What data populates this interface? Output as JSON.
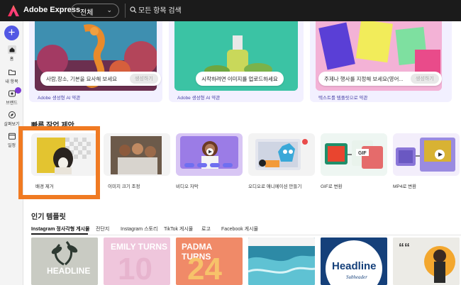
{
  "header": {
    "app_title": "Adobe Express",
    "scope_selected": "전체",
    "search_placeholder": "모든 항목 검색"
  },
  "rail": {
    "create_label": "+",
    "items": [
      {
        "label": "홈",
        "icon": "home-icon",
        "active": true
      },
      {
        "label": "내 항목",
        "icon": "folder-icon",
        "active": false
      },
      {
        "label": "브랜드",
        "icon": "brand-icon",
        "active": false
      },
      {
        "label": "살펴보기",
        "icon": "compass-icon",
        "active": false
      },
      {
        "label": "일정",
        "icon": "calendar-icon",
        "active": false
      }
    ]
  },
  "generative": {
    "cards": [
      {
        "prompt": "사람,장소, 기본을 묘사해 보세요",
        "button": "생성하기",
        "caption": "Adobe 생성형 AI 약관"
      },
      {
        "upload": "시작하려면 이미지를 업로드하세요",
        "caption": "Adobe 생성형 AI 약관"
      },
      {
        "prompt": "주제나 행사를 지정해 보세요(영어...",
        "button": "생성하기",
        "caption": "텍스트를 템플릿으로 약관"
      }
    ]
  },
  "quick_actions": {
    "title": "빠른 작업 제안",
    "items": [
      {
        "label": "배경 제거"
      },
      {
        "label": "이미지 크기 조정"
      },
      {
        "label": "비디오 자막"
      },
      {
        "label": "오디오로 애니메이션 만들기"
      },
      {
        "label": "GIF로 변환"
      },
      {
        "label": "MP4로 변환"
      }
    ]
  },
  "templates": {
    "title": "인기 템플릿",
    "tabs": [
      {
        "label": "Instagram 정사각형 게시물",
        "active": true
      },
      {
        "label": "전단지",
        "active": false
      },
      {
        "label": "Instagram 스토리",
        "active": false
      },
      {
        "label": "TikTok 게시물",
        "active": false
      },
      {
        "label": "로고",
        "active": false
      },
      {
        "label": "Facebook 게시물",
        "active": false
      }
    ],
    "cards": [
      {
        "text": "HEADLINE"
      },
      {
        "text": "EMILY TURNS",
        "big": "10"
      },
      {
        "text": "PADMA TURNS",
        "big": "24"
      },
      {
        "text": ""
      },
      {
        "text": "Headline",
        "sub": "Subheader"
      },
      {
        "text": "““"
      }
    ]
  },
  "colors": {
    "topbar": "#1b1b1b",
    "accent": "#5258e4",
    "highlight": "#f07a22"
  }
}
